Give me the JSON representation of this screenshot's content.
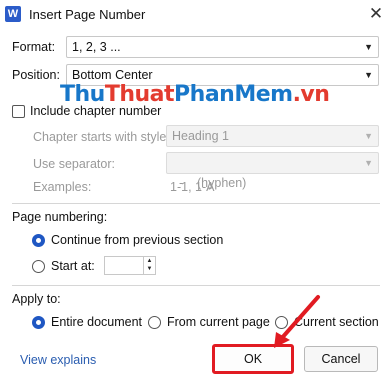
{
  "window": {
    "title": "Insert Page Number",
    "app_icon_letter": "W",
    "close_glyph": "✕"
  },
  "format": {
    "label": "Format:",
    "value": "1, 2, 3 ..."
  },
  "position": {
    "label": "Position:",
    "value": "Bottom Center"
  },
  "chapter": {
    "include_label": "Include chapter number",
    "include_checked": false,
    "starts_with_label": "Chapter starts with style:",
    "starts_with_value": "Heading 1",
    "separator_label": "Use separator:",
    "separator_value": "-    (hyphen)",
    "examples_label": "Examples:",
    "examples_value": "1-1, 1-A"
  },
  "numbering": {
    "label": "Page numbering:",
    "continue_label": "Continue from previous section",
    "start_at_label": "Start at:",
    "start_at_value": "",
    "selected": "continue"
  },
  "apply": {
    "label": "Apply to:",
    "options": [
      "Entire document",
      "From current page",
      "Current section"
    ],
    "selected": "Entire document"
  },
  "footer": {
    "link": "View explains",
    "ok_label": "OK",
    "cancel_label": "Cancel"
  },
  "watermark": {
    "part1": "Thu",
    "part2": "Thuat",
    "part3": "PhanMem",
    "part4": ".vn"
  },
  "colors": {
    "accent": "#1f57c3",
    "ok_highlight": "#e11b22",
    "arrow": "#e11b22",
    "link": "#2a5db0"
  }
}
